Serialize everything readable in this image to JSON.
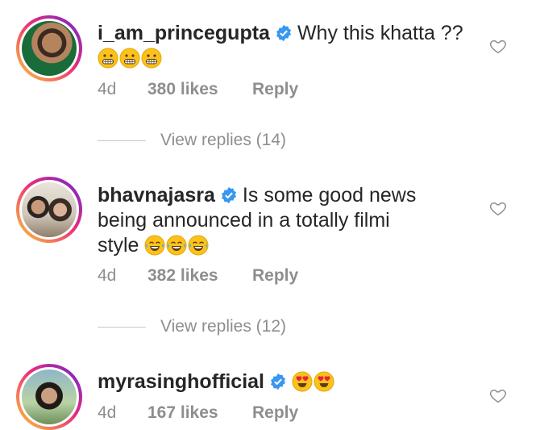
{
  "comments": [
    {
      "username": "i_am_princegupta",
      "text": "Why this khatta ??",
      "emoji": [
        "grimacing",
        "grimacing",
        "grimacing"
      ],
      "time": "4d",
      "likes": "380 likes",
      "reply": "Reply",
      "view_replies": "View replies (14)"
    },
    {
      "username": "bhavnajasra",
      "text_line1": "Is some good news",
      "text_line2": "being announced in a totally filmi",
      "text_line3": "style",
      "emoji": [
        "tears-of-joy",
        "tears-of-joy",
        "tears-of-joy"
      ],
      "time": "4d",
      "likes": "382 likes",
      "reply": "Reply",
      "view_replies": "View replies (12)"
    },
    {
      "username": "myrasinghofficial",
      "emoji": [
        "heart-eyes",
        "heart-eyes"
      ],
      "time": "4d",
      "likes": "167 likes",
      "reply": "Reply"
    }
  ],
  "colors": {
    "text": "#262626",
    "secondary": "#8e8e8e",
    "verified": "#3897f0"
  }
}
